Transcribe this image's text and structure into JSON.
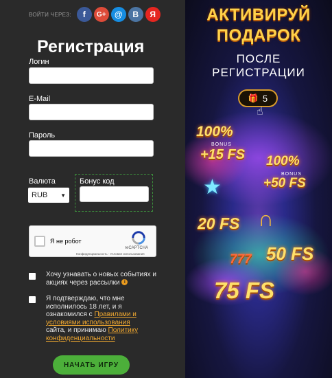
{
  "social": {
    "label": "ВОЙТИ ЧЕРЕЗ:",
    "buttons": [
      {
        "name": "facebook",
        "glyph": "f",
        "color": "#3b5998"
      },
      {
        "name": "google-plus",
        "glyph": "G+",
        "color": "#dd4b39"
      },
      {
        "name": "mail",
        "glyph": "@",
        "color": "#168de2"
      },
      {
        "name": "vk",
        "glyph": "В",
        "color": "#4c75a3"
      },
      {
        "name": "yandex",
        "glyph": "Я",
        "color": "#e52620"
      }
    ]
  },
  "form": {
    "title": "Регистрация",
    "login_label": "Логин",
    "email_label": "E-Mail",
    "password_label": "Пароль",
    "currency_label": "Валюта",
    "currency_value": "RUB",
    "bonus_label": "Бонус код"
  },
  "captcha": {
    "text": "Я не робот",
    "brand": "reCAPTCHA",
    "legal": "Конфиденциальность - Условия использования"
  },
  "checkboxes": {
    "newsletter": "Хочу узнавать о новых событиях и акциях через рассылки",
    "terms_prefix": "Я подтверждаю, что мне исполнилось 18 лет, и я ознакомился с",
    "terms_link": "Правилами и условиями использования",
    "terms_middle": "сайта, и принимаю",
    "privacy_link": "Политику конфиденциальности"
  },
  "start_button": "НАЧАТЬ ИГРУ",
  "promo": {
    "title_line1": "АКТИВИРУЙ",
    "title_line2": "ПОДАРОК",
    "sub_line1": "ПОСЛЕ",
    "sub_line2": "РЕГИСТРАЦИИ",
    "gift_count": "5",
    "prize1_percent": "100%",
    "prize1_bonus": "BONUS",
    "prize1_fs": "+15 FS",
    "prize2_percent": "100%",
    "prize2_bonus": "BONUS",
    "prize2_fs": "+50 FS",
    "prize3": "20 FS",
    "prize4": "50 FS",
    "prize5": "75 FS",
    "prize_777": "777"
  },
  "colors": {
    "accent_green": "#4caf3a",
    "link_orange": "#f0a830",
    "promo_gold": "#ffd24a"
  }
}
